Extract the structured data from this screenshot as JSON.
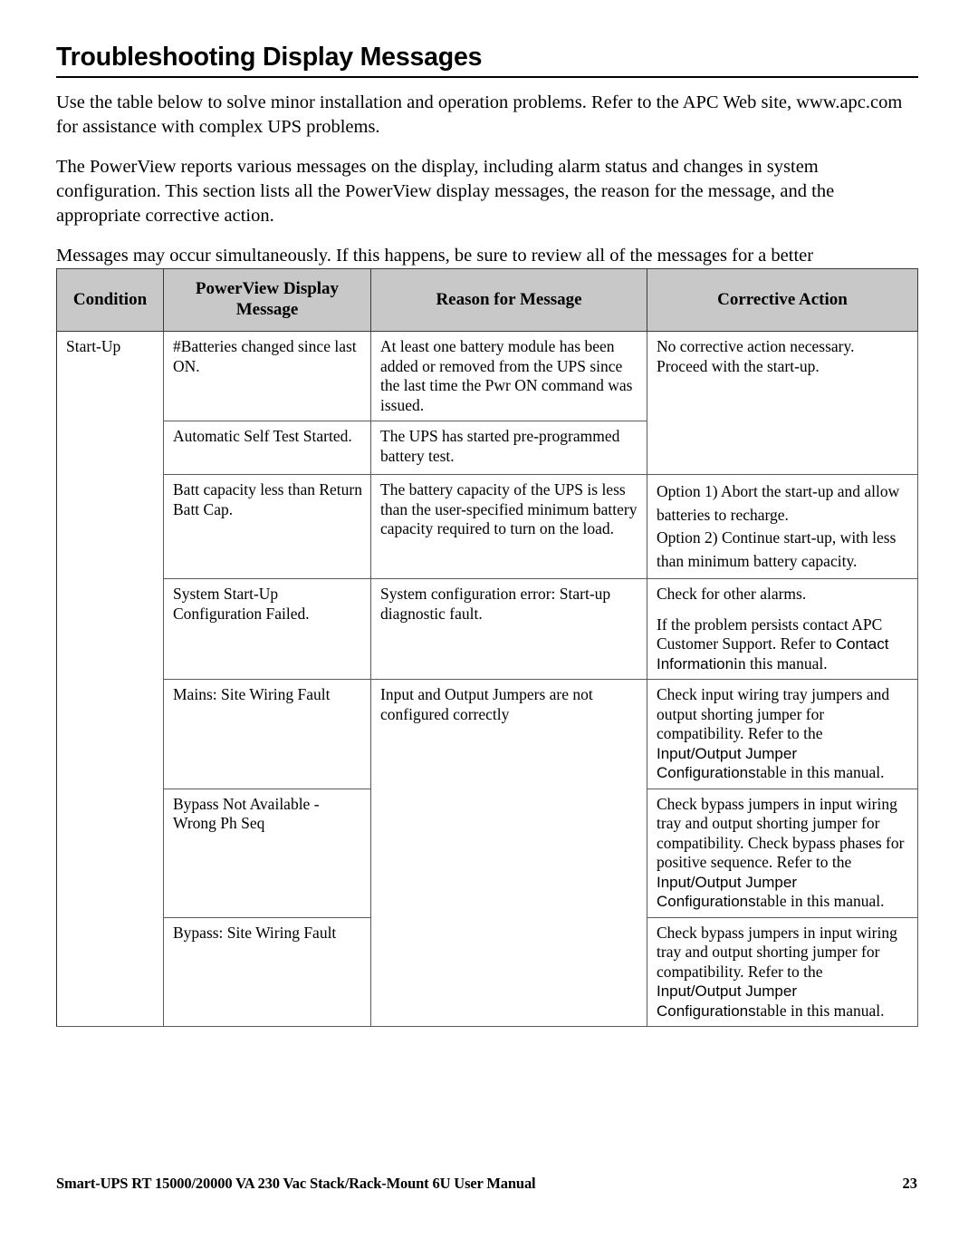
{
  "document": {
    "heading": "Troubleshooting Display Messages",
    "intro_paragraphs": [
      "Use the table below to solve minor installation and operation problems. Refer to the APC Web site, www.apc.com for assistance with complex UPS problems.",
      "The PowerView reports various messages on the display, including alarm status and changes in system configuration. This section lists all the PowerView display messages, the reason for the message, and the appropriate corrective action.",
      "Messages may occur simultaneously. If this happens, be sure to review all of the messages for a better understanding of the system condition."
    ]
  },
  "table": {
    "headers": {
      "condition": "Condition",
      "display_message": "PowerView Display Message",
      "reason": "Reason for Message",
      "corrective": "Corrective Action"
    },
    "condition_label": "Start-Up",
    "rows": [
      {
        "display_message": "#Batteries changed since last ON.",
        "reason": "At least one battery module has been added or removed from the UPS since the last time the Pwr ON command was issued.",
        "corrective_p1": "No corrective action necessary. Proceed with the start-up."
      },
      {
        "display_message": "Automatic Self Test Started.",
        "reason": "The UPS has started pre-programmed battery test."
      },
      {
        "display_message": "Batt capacity less than Return Batt Cap.",
        "reason": "The battery capacity of the UPS is less than the user-specified minimum battery capacity required to turn on the load.",
        "corrective_line1": "Option 1) Abort the start-up and allow batteries to recharge.",
        "corrective_line2": "Option 2) Continue start-up, with less than minimum battery capacity."
      },
      {
        "display_message": "System Start-Up Configuration Failed.",
        "reason": "System configuration error: Start-up diagnostic fault.",
        "corrective_p1": "Check for other alarms.",
        "corrective_p2_before": "If the problem persists contact APC Customer Support. Refer to ",
        "corrective_p2_xref": "Contact Information",
        "corrective_p2_after": "in this manual."
      },
      {
        "display_message": "Mains: Site Wiring Fault",
        "reason": "Input and Output Jumpers are not configured correctly",
        "corrective_before": "Check input wiring tray jumpers and output shorting jumper for compatibility. Refer to the ",
        "corrective_xref": "Input/Output Jumper Configurations",
        "corrective_after": "table in this manual."
      },
      {
        "display_message": "Bypass Not Available - Wrong Ph Seq",
        "corrective_before": "Check bypass jumpers in input wiring tray and output shorting jumper for compatibility. Check bypass phases for positive sequence. Refer to the ",
        "corrective_xref": "Input/Output Jumper Configurations",
        "corrective_after": "table in this manual."
      },
      {
        "display_message": "Bypass: Site Wiring Fault",
        "corrective_before": "Check bypass jumpers in input wiring tray and output shorting jumper for compatibility. Refer to the ",
        "corrective_xref": "Input/Output Jumper Configurations",
        "corrective_after": "table in this manual."
      }
    ]
  },
  "footer": {
    "manual_title": "Smart-UPS RT 15000/20000 VA  230 Vac  Stack/Rack-Mount 6U  User Manual",
    "page_number": "23"
  }
}
